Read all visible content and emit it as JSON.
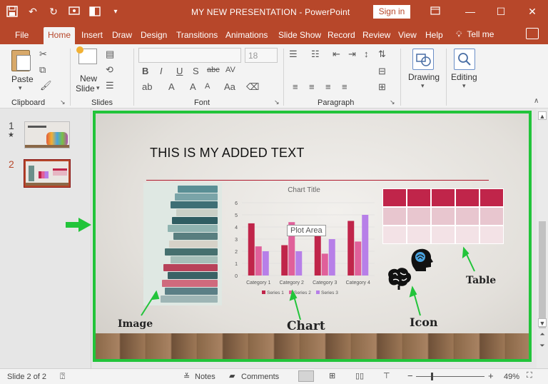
{
  "window": {
    "title": "MY NEW PRESENTATION  -  PowerPoint",
    "signin": "Sign in"
  },
  "tabs": [
    "File",
    "Home",
    "Insert",
    "Draw",
    "Design",
    "Transitions",
    "Animations",
    "Slide Show",
    "Record",
    "Review",
    "View",
    "Help"
  ],
  "tell_me": "Tell me",
  "ribbon": {
    "clipboard": {
      "label": "Clipboard",
      "paste": "Paste"
    },
    "slides": {
      "label": "Slides",
      "new_slide_1": "New",
      "new_slide_2": "Slide"
    },
    "font": {
      "label": "Font",
      "name": "",
      "size": "18"
    },
    "paragraph": {
      "label": "Paragraph"
    },
    "drawing": "Drawing",
    "editing": "Editing"
  },
  "thumbnails": [
    {
      "num": "1",
      "star": "★"
    },
    {
      "num": "2"
    }
  ],
  "slide": {
    "title": "THIS IS MY ADDED TEXT",
    "labels": {
      "image": "Image",
      "chart": "Chart",
      "icon": "Icon",
      "table": "Table"
    },
    "tooltip": "Plot Area"
  },
  "chart_data": {
    "type": "bar",
    "title": "Chart Title",
    "categories": [
      "Category 1",
      "Category 2",
      "Category 3",
      "Category 4"
    ],
    "series": [
      {
        "name": "Series 1",
        "values": [
          4.3,
          2.5,
          3.5,
          4.5
        ],
        "color": "#c0254a"
      },
      {
        "name": "Series 2",
        "values": [
          2.4,
          4.4,
          1.8,
          2.8
        ],
        "color": "#e0609a"
      },
      {
        "name": "Series 3",
        "values": [
          2.0,
          2.0,
          3.0,
          5.0
        ],
        "color": "#b77fe8"
      }
    ],
    "ylim": [
      0,
      6
    ],
    "yticks": [
      "0",
      "1",
      "2",
      "3",
      "4",
      "5",
      "6"
    ],
    "legend": "bottom",
    "grid": true
  },
  "status": {
    "slide_count": "Slide 2 of 2",
    "notes": "Notes",
    "comments": "Comments",
    "zoom": "49%"
  },
  "colors": {
    "accent": "#b7472a",
    "highlight_frame": "#22c43a",
    "arrow": "#22c43a",
    "table_header": "#c0254a"
  }
}
